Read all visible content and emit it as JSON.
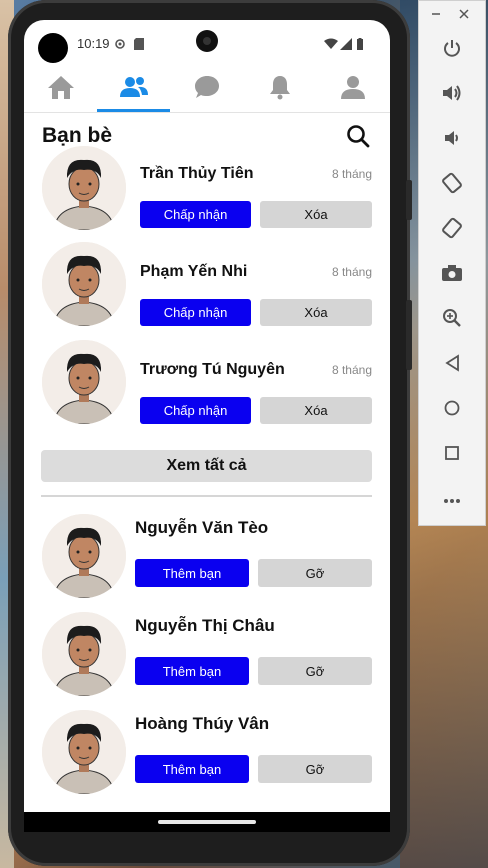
{
  "status": {
    "time": "10:19"
  },
  "nav_tabs": [
    {
      "icon": "home-icon"
    },
    {
      "icon": "friends-icon",
      "active": true
    },
    {
      "icon": "chat-icon"
    },
    {
      "icon": "bell-icon"
    },
    {
      "icon": "profile-icon"
    }
  ],
  "page": {
    "title": "Bạn bè"
  },
  "requests": [
    {
      "name": "Trần Thủy Tiên",
      "time": "8 tháng",
      "accept": "Chấp nhận",
      "delete": "Xóa"
    },
    {
      "name": "Phạm Yến Nhi",
      "time": "8 tháng",
      "accept": "Chấp nhận",
      "delete": "Xóa"
    },
    {
      "name": "Trương Tú Nguyên",
      "time": "8 tháng",
      "accept": "Chấp nhận",
      "delete": "Xóa"
    }
  ],
  "see_all": "Xem tất cả",
  "suggestions": [
    {
      "name": "Nguyễn Văn Tèo",
      "add": "Thêm bạn",
      "remove": "Gỡ"
    },
    {
      "name": "Nguyễn Thị Châu",
      "add": "Thêm bạn",
      "remove": "Gỡ"
    },
    {
      "name": "Hoàng Thúy Vân",
      "add": "Thêm bạn",
      "remove": "Gỡ"
    }
  ],
  "emulator_panel": {
    "controls": [
      "minimize",
      "close"
    ],
    "buttons": [
      "power-icon",
      "volume-up-icon",
      "volume-down-icon",
      "rotate-left-icon",
      "rotate-right-icon",
      "camera-icon",
      "zoom-icon",
      "back-icon",
      "home-icon",
      "overview-icon",
      "more-icon"
    ]
  },
  "colors": {
    "primary_button": "#0a00f0",
    "secondary_button": "#d5d5d5",
    "active_tab": "#1b8be6"
  }
}
